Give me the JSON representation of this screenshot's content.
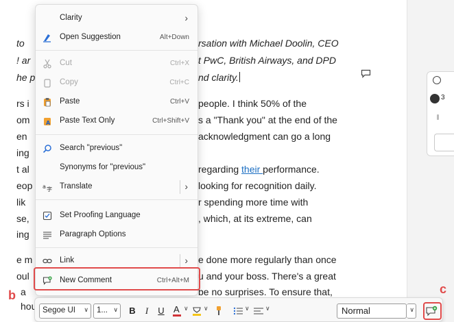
{
  "document": {
    "lines": [
      {
        "left": "to",
        "right": "rsation with Michael Doolin, CEO",
        "italic": true
      },
      {
        "left": "! ar",
        "right": "t PwC, British Airways, and DPD",
        "italic": true
      },
      {
        "left": "he p",
        "right": "nd clarity.",
        "italic": true
      },
      {
        "left": "rs i",
        "right": "people. I think 50% of the"
      },
      {
        "left": "om",
        "right": "s a \"Thank you\" at the end of the"
      },
      {
        "left": "en",
        "right": "acknowledgment can go a long"
      },
      {
        "left": "ing",
        "right": ""
      },
      {
        "left": "t al",
        "right_pre": "regarding ",
        "right_link": "their ",
        "right_post": "performance."
      },
      {
        "left": "eop",
        "right": "looking for recognition daily."
      },
      {
        "left": "lik",
        "right": "r spending more time with"
      },
      {
        "left": "se,",
        "right": ", which, at its extreme, can"
      },
      {
        "left": "ing",
        "right": ""
      },
      {
        "left": "e m",
        "right": "e done more regularly than once"
      },
      {
        "left": "oul",
        "right": "u and your boss. There's a great"
      },
      {
        "left": "a",
        "right": "be no surprises. To ensure that,"
      },
      {
        "left": "hou",
        "right": ""
      }
    ]
  },
  "side_panel": {
    "avatar_text": "3"
  },
  "context_menu": {
    "items": {
      "clarity": {
        "label": "Clarity"
      },
      "open_suggestion": {
        "label": "Open Suggestion",
        "shortcut": "Alt+Down"
      },
      "cut": {
        "label": "Cut",
        "shortcut": "Ctrl+X"
      },
      "copy": {
        "label": "Copy",
        "shortcut": "Ctrl+C"
      },
      "paste": {
        "label": "Paste",
        "shortcut": "Ctrl+V"
      },
      "paste_text_only": {
        "label": "Paste Text Only",
        "shortcut": "Ctrl+Shift+V"
      },
      "search": {
        "label": "Search \"previous\""
      },
      "synonyms": {
        "label": "Synonyms for \"previous\""
      },
      "translate": {
        "label": "Translate"
      },
      "set_proofing_language": {
        "label": "Set Proofing Language"
      },
      "paragraph_options": {
        "label": "Paragraph Options"
      },
      "link": {
        "label": "Link"
      },
      "new_comment": {
        "label": "New Comment",
        "shortcut": "Ctrl+Alt+M"
      }
    }
  },
  "toolbar": {
    "font_name": "Segoe UI",
    "font_size": "1...",
    "style": "Normal",
    "bold": "B",
    "italic": "I",
    "underline": "U",
    "font_color_glyph": "A"
  },
  "annotations": {
    "b": "b",
    "c": "c"
  },
  "colors": {
    "accent": "#1b6ec2",
    "highlight": "#e04a4a",
    "font_color_bar": "#d13438",
    "highlighter_bar": "#f5c518"
  }
}
